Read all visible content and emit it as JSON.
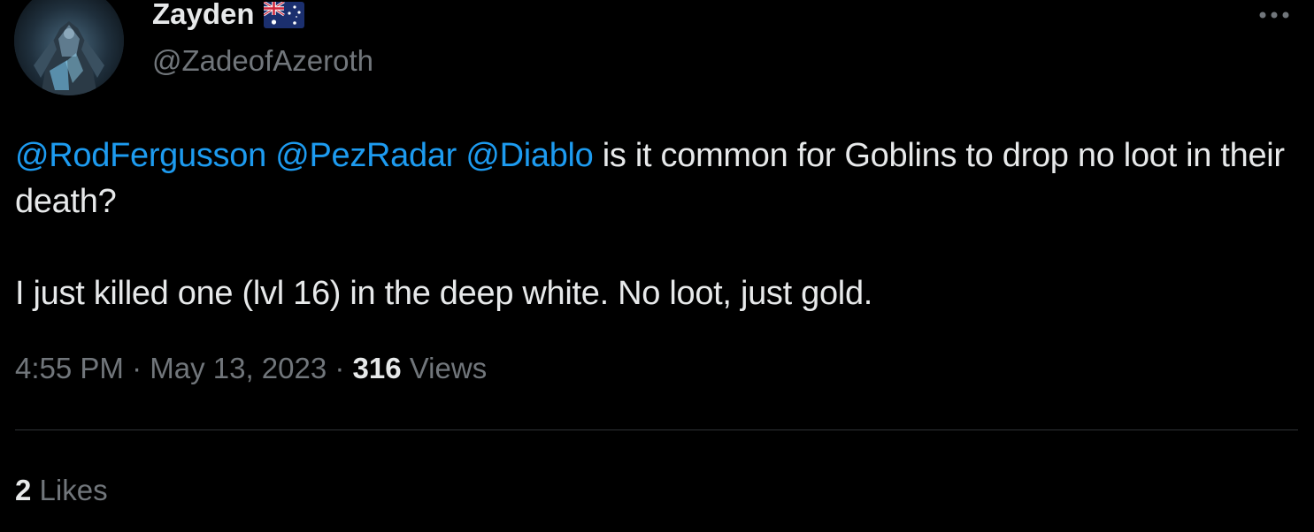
{
  "author": {
    "display_name": "Zayden",
    "handle": "@ZadeofAzeroth",
    "flag_icon": "australia-flag-icon",
    "avatar_icon": "armored-knight-avatar"
  },
  "tweet": {
    "mentions": [
      "@RodFergusson",
      "@PezRadar",
      "@Diablo"
    ],
    "text_line1": " is it common for Goblins to drop no loot in their death?",
    "text_paragraph2": "I just killed one (lvl 16) in the deep white. No loot,  just gold."
  },
  "meta": {
    "time": "4:55 PM",
    "separator": " · ",
    "date": "May 13, 2023",
    "views_count": "316",
    "views_label": " Views"
  },
  "engagement": {
    "likes_count": "2",
    "likes_label": " Likes"
  },
  "colors": {
    "background": "#000000",
    "text": "#e7e9ea",
    "secondary": "#71767b",
    "link": "#1d9bf0",
    "divider": "#2f3336"
  },
  "icons": {
    "more": "more-options-icon"
  }
}
